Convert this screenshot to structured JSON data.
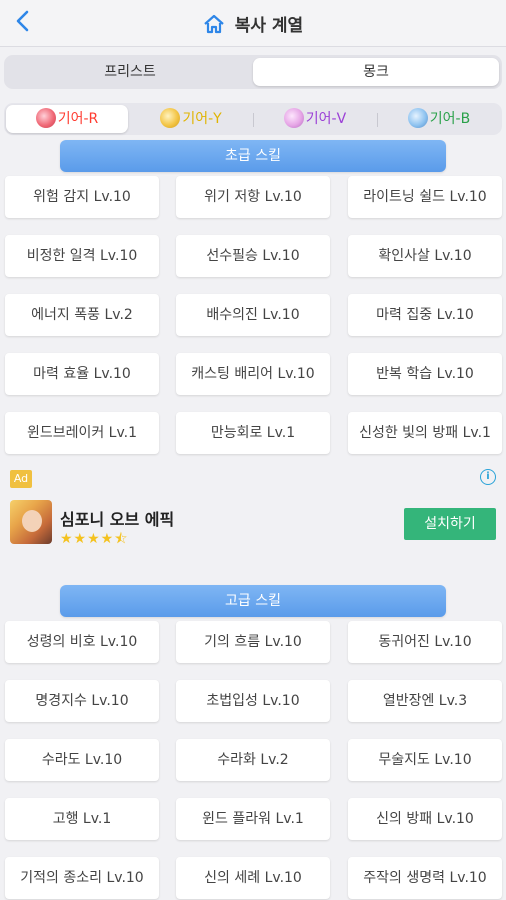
{
  "header": {
    "title": "복사 계열",
    "back_icon": "chevron-left-icon",
    "title_icon": "home-icon"
  },
  "class_tabs": [
    {
      "label": "프리스트",
      "selected": false
    },
    {
      "label": "몽크",
      "selected": true
    }
  ],
  "gear_tabs": [
    {
      "label": "기어-R",
      "color": "#ff3b30",
      "gem": "#f06a78",
      "selected": true
    },
    {
      "label": "기어-Y",
      "color": "#e0b400",
      "gem": "#f3c546",
      "selected": false
    },
    {
      "label": "기어-V",
      "color": "#9b3fd6",
      "gem": "#e6a6e6",
      "selected": false
    },
    {
      "label": "기어-B",
      "color": "#2aa14a",
      "gem": "#8fc3f0",
      "selected": false
    }
  ],
  "basic_section": {
    "title": "초급 스킬",
    "skills": [
      "위험 감지 Lv.10",
      "위기 저항 Lv.10",
      "라이트닝 쉴드 Lv.10",
      "비정한 일격 Lv.10",
      "선수필승 Lv.10",
      "확인사살 Lv.10",
      "에너지 폭풍 Lv.2",
      "배수의진 Lv.10",
      "마력 집중 Lv.10",
      "마력 효율 Lv.10",
      "캐스팅 배리어 Lv.10",
      "반복 학습 Lv.10",
      "윈드브레이커 Lv.1",
      "만능회로 Lv.1",
      "신성한 빛의 방패 Lv.1"
    ]
  },
  "ad": {
    "badge": "Ad",
    "info_icon": "info-icon",
    "title": "심포니 오브 에픽",
    "rating": 4.5,
    "stars": "★★★★⯪",
    "install_label": "설치하기"
  },
  "advanced_section": {
    "title": "고급 스킬",
    "skills": [
      "성령의 비호 Lv.10",
      "기의 흐름 Lv.10",
      "동귀어진 Lv.10",
      "명경지수 Lv.10",
      "초법입성 Lv.10",
      "열반장엔 Lv.3",
      "수라도 Lv.10",
      "수라화 Lv.2",
      "무술지도 Lv.10",
      "고행 Lv.1",
      "윈드 플라워 Lv.1",
      "신의 방패 Lv.10",
      "기적의 종소리 Lv.10",
      "신의 세례 Lv.10",
      "주작의 생명력 Lv.10"
    ]
  }
}
